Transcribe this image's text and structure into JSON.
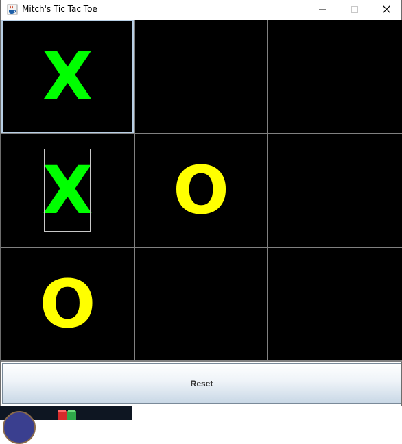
{
  "window": {
    "title": "Mitch's Tic Tac Toe"
  },
  "board": {
    "cells": [
      {
        "mark": "X",
        "focused": true
      },
      {
        "mark": ""
      },
      {
        "mark": ""
      },
      {
        "mark": "X",
        "focus_ring": true
      },
      {
        "mark": "O"
      },
      {
        "mark": ""
      },
      {
        "mark": "O"
      },
      {
        "mark": ""
      },
      {
        "mark": ""
      }
    ]
  },
  "reset_button": {
    "label": "Reset"
  },
  "colors": {
    "x_mark": "#00ff00",
    "o_mark": "#ffff00",
    "cell_background": "#000000",
    "grid_lines": "#808080"
  },
  "icons": {
    "app": "java-coffee-cup-icon",
    "minimize": "minimize-icon",
    "maximize": "maximize-icon",
    "close": "close-icon"
  }
}
